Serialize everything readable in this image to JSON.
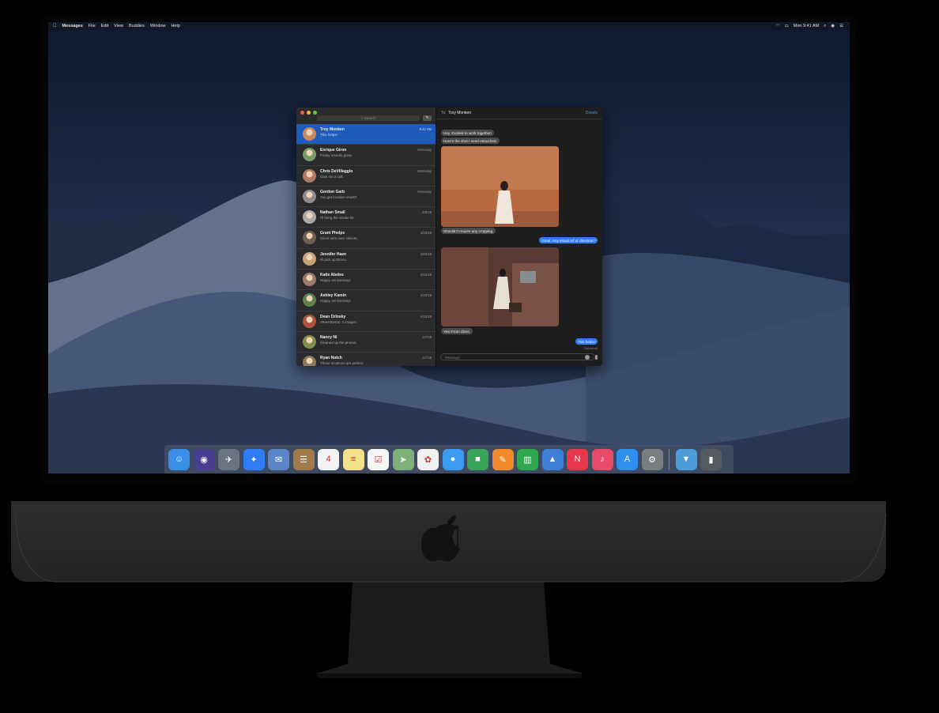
{
  "menubar": {
    "app_name": "Messages",
    "menus": [
      "File",
      "Edit",
      "View",
      "Buddies",
      "Window",
      "Help"
    ],
    "clock": "Mon 9:41 AM"
  },
  "sidebar": {
    "search_placeholder": "Search",
    "conversations": [
      {
        "name": "Troy Monken",
        "preview": "This helps!",
        "date": "9:41 AM",
        "selected": true,
        "avatar_color": "#c98a5a"
      },
      {
        "name": "Enrique Giron",
        "preview": "Friday sounds great.",
        "date": "Yesterday",
        "selected": false,
        "avatar_color": "#7a9a6a"
      },
      {
        "name": "Chris DeVillaggio",
        "preview": "Give me a call.",
        "date": "Yesterday",
        "selected": false,
        "avatar_color": "#b07a62"
      },
      {
        "name": "Gordon Garb",
        "preview": "You get location shots?",
        "date": "Yesterday",
        "selected": false,
        "avatar_color": "#8c8c8c"
      },
      {
        "name": "Nathan Small",
        "preview": "I'll bring the strobe kit.",
        "date": "5/6/18",
        "selected": false,
        "avatar_color": "#a9a9a9"
      },
      {
        "name": "Grant Phelps",
        "preview": "Client sent over selects.",
        "date": "4/25/18",
        "selected": false,
        "avatar_color": "#6f5f52"
      },
      {
        "name": "Jennifer Haen",
        "preview": "I'll pick up Bruno.",
        "date": "4/20/18",
        "selected": false,
        "avatar_color": "#c4a37a"
      },
      {
        "name": "Katie Abeles",
        "preview": "Happy anniversary!",
        "date": "4/10/18",
        "selected": false,
        "avatar_color": "#9c7a6a"
      },
      {
        "name": "Ashley Kamin",
        "preview": "Happy anniversary!",
        "date": "4/10/18",
        "selected": false,
        "avatar_color": "#5f7f4f"
      },
      {
        "name": "Dean Orlosky",
        "preview": "Attachments: 2 images",
        "date": "4/10/18",
        "selected": false,
        "avatar_color": "#b0503f"
      },
      {
        "name": "Nancy Ni",
        "preview": "Cleaned up the photos.",
        "date": "4/7/18",
        "selected": false,
        "avatar_color": "#7f8f4a"
      },
      {
        "name": "Ryan Notch",
        "preview": "These locations are perfect.",
        "date": "4/7/18",
        "selected": false,
        "avatar_color": "#8c7a5e"
      }
    ]
  },
  "chat": {
    "to_label": "To:",
    "recipient": "Troy Monken",
    "details_label": "Details",
    "messages": {
      "m1": "Hey. Excited to work together!",
      "m2": "Here's the shot I need retouched.",
      "m3": "Shouldn't require any cropping.",
      "m4": "Great. Any visual ref or direction?",
      "m5": "Yes! From client.",
      "m6": "This helps!"
    },
    "delivered": "Delivered",
    "input_placeholder": "Message"
  },
  "dock": {
    "icons": [
      {
        "name": "finder-icon",
        "color": "#3a8ee6",
        "glyph": "☺"
      },
      {
        "name": "siri-icon",
        "color": "#4a3f8f",
        "glyph": "◉"
      },
      {
        "name": "launchpad-icon",
        "color": "#6b7280",
        "glyph": "✈"
      },
      {
        "name": "safari-icon",
        "color": "#2f7cf6",
        "glyph": "✦"
      },
      {
        "name": "mail-icon",
        "color": "#5a86c8",
        "glyph": "✉"
      },
      {
        "name": "contacts-icon",
        "color": "#a07a4a",
        "glyph": "☰"
      },
      {
        "name": "calendar-icon",
        "color": "#f3f3f3",
        "glyph": "4"
      },
      {
        "name": "notes-icon",
        "color": "#f2e08a",
        "glyph": "≡"
      },
      {
        "name": "reminders-icon",
        "color": "#f5f5f5",
        "glyph": "☑"
      },
      {
        "name": "maps-icon",
        "color": "#7fb07a",
        "glyph": "➤"
      },
      {
        "name": "photos-icon",
        "color": "#f0f0f0",
        "glyph": "✿"
      },
      {
        "name": "messages-icon",
        "color": "#3c9bf0",
        "glyph": "●"
      },
      {
        "name": "facetime-icon",
        "color": "#3aa55a",
        "glyph": "■"
      },
      {
        "name": "pages-icon",
        "color": "#f08a2a",
        "glyph": "✎"
      },
      {
        "name": "numbers-icon",
        "color": "#2fa84f",
        "glyph": "▥"
      },
      {
        "name": "keynote-icon",
        "color": "#3f7fd8",
        "glyph": "▲"
      },
      {
        "name": "news-icon",
        "color": "#e8364a",
        "glyph": "N"
      },
      {
        "name": "music-icon",
        "color": "#e84a6a",
        "glyph": "♪"
      },
      {
        "name": "appstore-icon",
        "color": "#2f8ff0",
        "glyph": "A"
      },
      {
        "name": "system-preferences-icon",
        "color": "#7a7d82",
        "glyph": "⚙"
      }
    ],
    "folder": {
      "name": "downloads-folder-icon",
      "color": "#4a9bd8",
      "glyph": "▼"
    },
    "trash": {
      "name": "trash-icon",
      "color": "#555a60",
      "glyph": "▮"
    }
  }
}
